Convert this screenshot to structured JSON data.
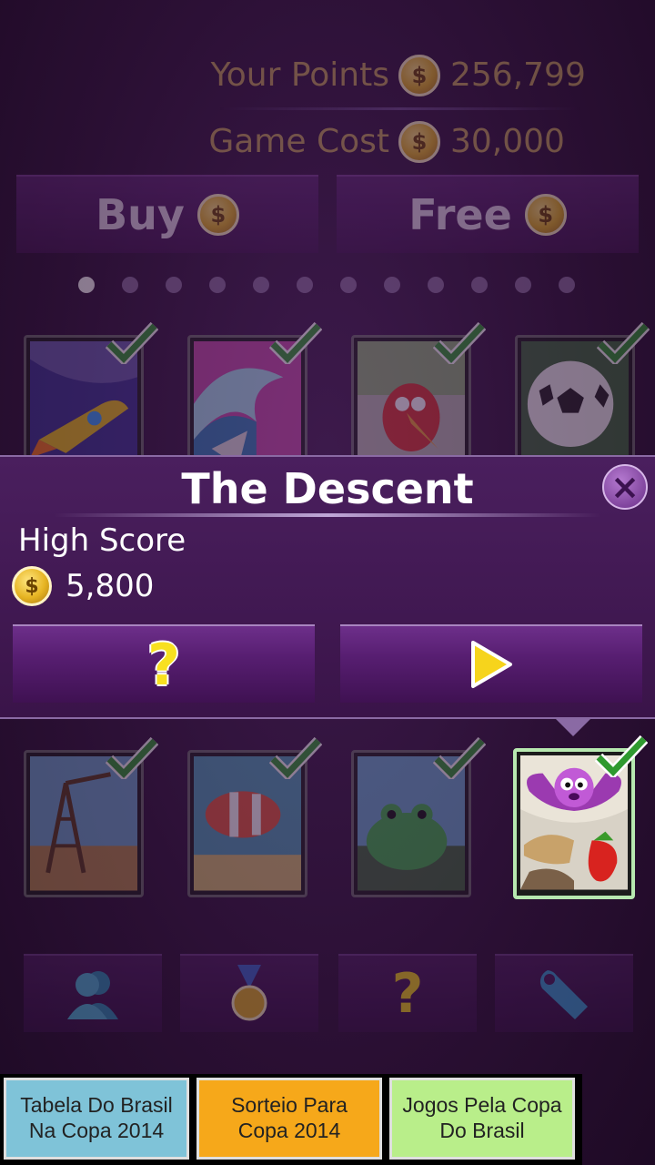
{
  "header": {
    "your_points_label": "Your Points",
    "your_points_value": "256,799",
    "game_cost_label": "Game Cost",
    "game_cost_value": "30,000",
    "buy_label": "Buy",
    "free_label": "Free",
    "coin_symbol": "$"
  },
  "pager": {
    "count": 12,
    "active_index": 0
  },
  "games_top": [
    {
      "icon": "rocket-ship-icon",
      "completed": true
    },
    {
      "icon": "wave-surf-icon",
      "completed": true
    },
    {
      "icon": "red-bird-icon",
      "completed": true
    },
    {
      "icon": "soccer-ball-icon",
      "completed": true
    }
  ],
  "popup": {
    "title": "The Descent",
    "close_symbol": "×",
    "high_score_label": "High Score",
    "high_score_value": "5,800",
    "help_symbol": "?",
    "play_icon": "play-icon"
  },
  "games_bottom": [
    {
      "icon": "oil-derrick-icon",
      "completed": true
    },
    {
      "icon": "clownfish-icon",
      "completed": true
    },
    {
      "icon": "frog-icon",
      "completed": true
    },
    {
      "icon": "bat-strawberry-icon",
      "completed": true,
      "selected": true
    }
  ],
  "bottom_nav": {
    "items": [
      "profile-icon",
      "medal-icon",
      "help-icon",
      "wrench-icon"
    ],
    "help_symbol": "?"
  },
  "ads": [
    {
      "line1": "Tabela Do Brasil",
      "line2": "Na Copa 2014",
      "color": "#7fc3d8"
    },
    {
      "line1": "Sorteio Para",
      "line2": "Copa 2014",
      "color": "#f6a81a"
    },
    {
      "line1": "Jogos Pela Copa",
      "line2": "Do Brasil",
      "color": "#b9ee8a"
    }
  ],
  "colors": {
    "background": "#2a0f33",
    "popup": "#4a1f5e",
    "gold": "#c7a45a",
    "check_green": "#2f9a2f"
  }
}
